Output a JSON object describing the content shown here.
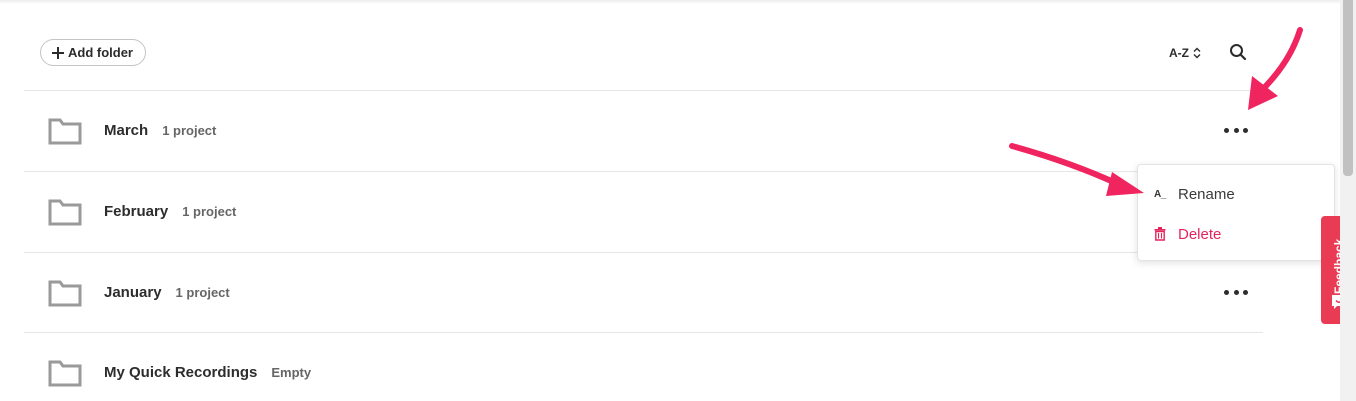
{
  "toolbar": {
    "add_folder_label": "Add folder",
    "sort_label": "A-Z",
    "sort_icon": "chevron-up-down-icon",
    "search_icon": "search-icon"
  },
  "folders": [
    {
      "name": "March",
      "meta": "1 project",
      "has_menu": true
    },
    {
      "name": "February",
      "meta": "1 project",
      "has_menu": false
    },
    {
      "name": "January",
      "meta": "1 project",
      "has_menu": true
    },
    {
      "name": "My Quick Recordings",
      "meta": "Empty",
      "has_menu": false
    }
  ],
  "context_menu": {
    "rename_glyph": "A_",
    "rename_label": "Rename",
    "delete_label": "Delete",
    "delete_icon": "trash-icon"
  },
  "feedback": {
    "label": "Feedback",
    "icon": "smile-chat-icon"
  },
  "colors": {
    "accent": "#e5245e",
    "annotation_arrow": "#f0245f",
    "feedback_bg": "#ea3b55",
    "folder_icon": "#9a9a9a"
  }
}
